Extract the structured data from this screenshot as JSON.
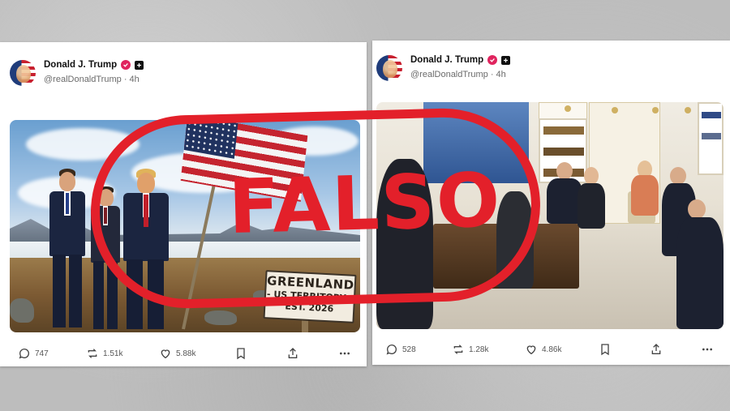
{
  "posts": [
    {
      "author": "Donald J. Trump",
      "handle": "@realDonaldTrump",
      "time": "4h",
      "image": {
        "sign_lines": [
          "GREENLAND",
          "- US TERRITORY -",
          "EST. 2026"
        ]
      },
      "stats": {
        "replies": "747",
        "reposts": "1.51k",
        "likes": "5.88k"
      }
    },
    {
      "author": "Donald J. Trump",
      "handle": "@realDonaldTrump",
      "time": "4h",
      "stats": {
        "replies": "528",
        "reposts": "1.28k",
        "likes": "4.86k"
      }
    }
  ],
  "stamp": {
    "label": "FALSO",
    "color": "#e3202a"
  },
  "icons": [
    "reply-icon",
    "repost-icon",
    "like-icon",
    "bookmark-icon",
    "share-icon",
    "more-icon",
    "verified-icon",
    "plus-badge-icon"
  ],
  "colors": {
    "verified": "#e0245e",
    "stamp": "#e3202a"
  }
}
